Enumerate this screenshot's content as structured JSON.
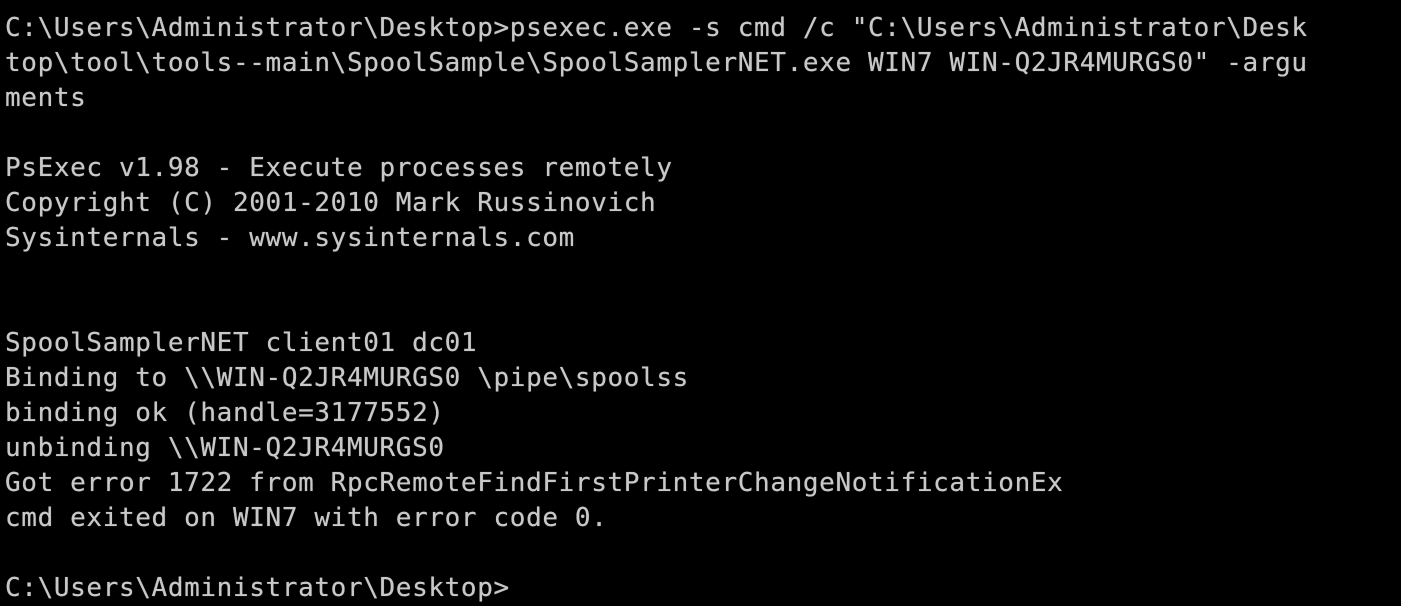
{
  "console": {
    "lines": [
      "C:\\Users\\Administrator\\Desktop>psexec.exe -s cmd /c \"C:\\Users\\Administrator\\Desk",
      "top\\tool\\tools--main\\SpoolSample\\SpoolSamplerNET.exe WIN7 WIN-Q2JR4MURGS0\" -argu",
      "ments",
      "",
      "PsExec v1.98 - Execute processes remotely",
      "Copyright (C) 2001-2010 Mark Russinovich",
      "Sysinternals - www.sysinternals.com",
      "",
      "",
      "SpoolSamplerNET client01 dc01",
      "Binding to \\\\WIN-Q2JR4MURGS0 \\pipe\\spoolss",
      "binding ok (handle=3177552)",
      "unbinding \\\\WIN-Q2JR4MURGS0",
      "Got error 1722 from RpcRemoteFindFirstPrinterChangeNotificationEx",
      "cmd exited on WIN7 with error code 0.",
      "",
      "C:\\Users\\Administrator\\Desktop>"
    ]
  },
  "colors": {
    "background": "#000000",
    "text": "#c8c8c8"
  }
}
